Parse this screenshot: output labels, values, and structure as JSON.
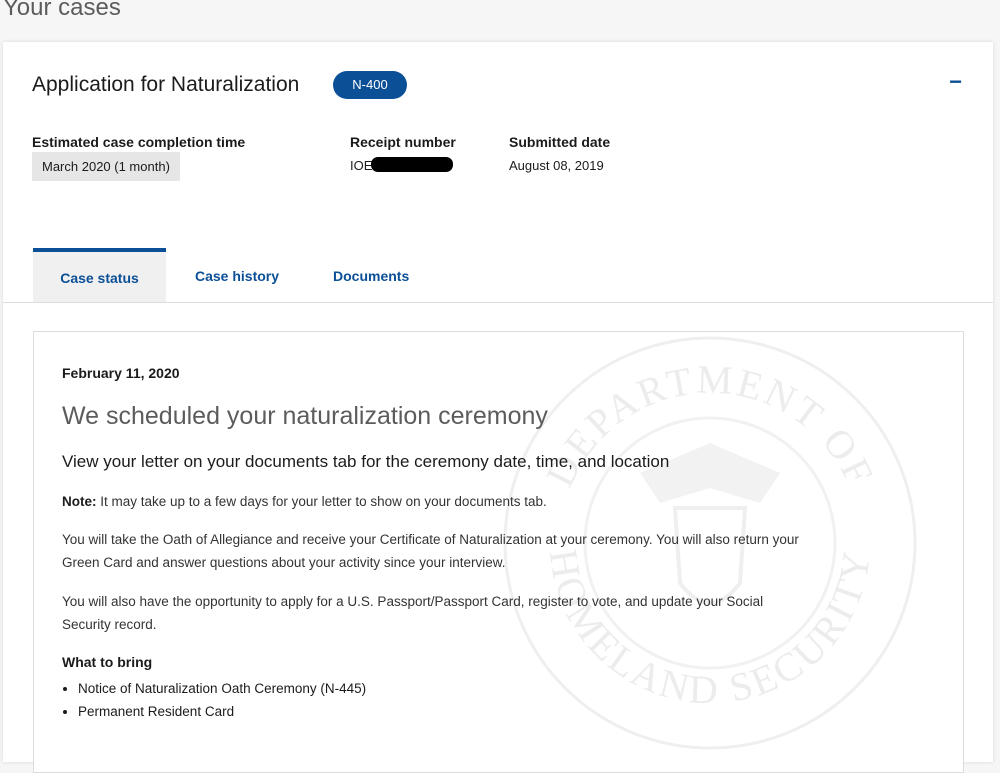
{
  "page": {
    "title": "Your cases"
  },
  "case": {
    "title": "Application for Naturalization",
    "form": "N-400",
    "collapse_label": "−",
    "estimated_label": "Estimated case completion time",
    "estimated_value": "March 2020 (1 month)",
    "receipt_label": "Receipt number",
    "receipt_value": "IOE",
    "submitted_label": "Submitted date",
    "submitted_value": "August 08, 2019"
  },
  "tabs": [
    {
      "label": "Case status",
      "active": true
    },
    {
      "label": "Case history",
      "active": false
    },
    {
      "label": "Documents",
      "active": false
    }
  ],
  "status": {
    "date": "February 11, 2020",
    "title": "We scheduled your naturalization ceremony",
    "subtitle": "View your letter on your documents tab for the ceremony date, time, and location",
    "note_label": "Note:",
    "note_text": " It may take up to a few days for your letter to show on your documents tab.",
    "paragraph1": "You will take the Oath of Allegiance and receive your Certificate of Naturalization at your ceremony. You will also return your Green Card and answer questions about your activity since your interview.",
    "paragraph2": "You will also have the opportunity to apply for a U.S. Passport/Passport Card, register to vote, and update your Social Security record.",
    "bring_heading": "What to bring",
    "bring_items": [
      "Notice of Naturalization Oath Ceremony (N-445)",
      "Permanent Resident Card"
    ]
  },
  "watermark": {
    "text": "DEPARTMENT OF HOMELAND SECURITY",
    "icon": "dhs-seal-icon"
  },
  "colors": {
    "accent": "#0b4f96",
    "badge": "#0b4f96",
    "muted": "#5c5c5c"
  }
}
